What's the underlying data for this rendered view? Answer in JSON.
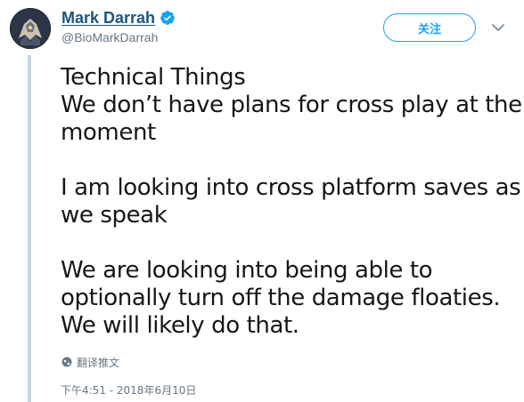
{
  "author": {
    "display_name": "Mark Darrah",
    "handle": "@BioMarkDarrah",
    "verified": true,
    "avatar_icon": "avatar-icon"
  },
  "follow_button": {
    "label": "关注"
  },
  "menu_icon": "chevron-down-icon",
  "tweet": {
    "paragraphs": [
      [
        "Technical Things",
        "We don’t have plans for cross play at the",
        "moment"
      ],
      [
        "I am looking into cross platform saves as",
        "we speak"
      ],
      [
        "We are looking into being able to",
        "optionally turn off the damage floaties.",
        "We will likely do that."
      ]
    ]
  },
  "translate": {
    "label": "翻译推文",
    "icon": "globe-icon"
  },
  "timestamp": "下午4:51 - 2018年6月10日",
  "colors": {
    "name": "#1b557f",
    "accent": "#1da1f2",
    "secondary_text": "#657786",
    "thread_line": "#c9d6e0"
  }
}
